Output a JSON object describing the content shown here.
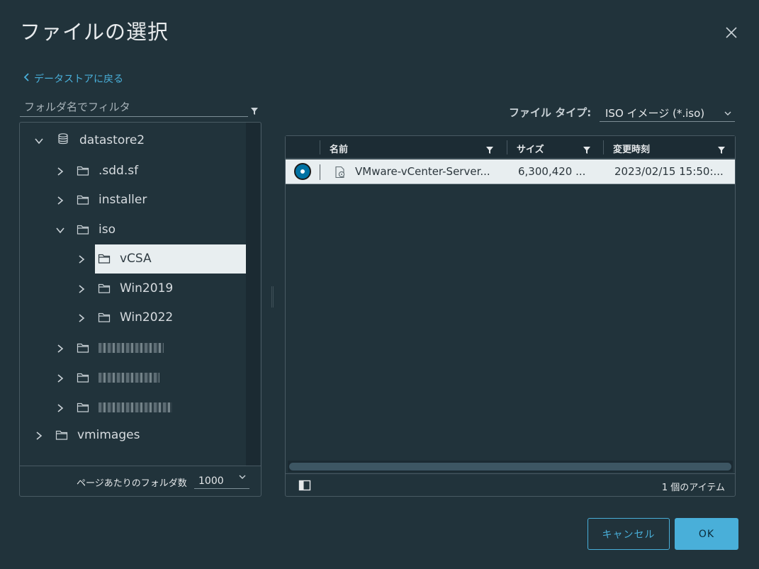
{
  "dialog": {
    "title": "ファイルの選択",
    "back_link": "データストアに戻る"
  },
  "folder_filter": {
    "placeholder": "フォルダ名でフィルタ"
  },
  "tree": {
    "nodes": [
      {
        "label": "datastore2",
        "expanded": true,
        "icon": "database-icon"
      },
      {
        "label": ".sdd.sf",
        "expanded": false,
        "icon": "folder-icon"
      },
      {
        "label": "installer",
        "expanded": false,
        "icon": "folder-icon"
      },
      {
        "label": "iso",
        "expanded": true,
        "icon": "folder-icon"
      },
      {
        "label": "vCSA",
        "expanded": false,
        "icon": "folder-icon",
        "selected": true
      },
      {
        "label": "Win2019",
        "expanded": false,
        "icon": "folder-icon"
      },
      {
        "label": "Win2022",
        "expanded": false,
        "icon": "folder-icon"
      },
      {
        "label": "",
        "expanded": false,
        "icon": "folder-icon",
        "redacted": true
      },
      {
        "label": "",
        "expanded": false,
        "icon": "folder-icon",
        "redacted": true
      },
      {
        "label": "",
        "expanded": false,
        "icon": "folder-icon",
        "redacted": true
      },
      {
        "label": "vmimages",
        "expanded": false,
        "icon": "folder-icon"
      }
    ],
    "footer_label": "ページあたりのフォルダ数",
    "page_size": "1000"
  },
  "file_type": {
    "label": "ファイル タイプ:",
    "value": "ISO イメージ (*.iso)"
  },
  "grid": {
    "columns": [
      "名前",
      "サイズ",
      "変更時刻"
    ],
    "rows": [
      {
        "name": "VMware-vCenter-Server...",
        "size": "6,300,420 ...",
        "modified": "2023/02/15 15:50:...",
        "selected": true,
        "icon": "disc-file-icon"
      }
    ],
    "item_count": "1 個のアイテム"
  },
  "buttons": {
    "cancel": "キャンセル",
    "ok": "OK"
  },
  "colors": {
    "background": "#21333b",
    "accent": "#49afd9",
    "selected_row": "#e8eef0"
  }
}
